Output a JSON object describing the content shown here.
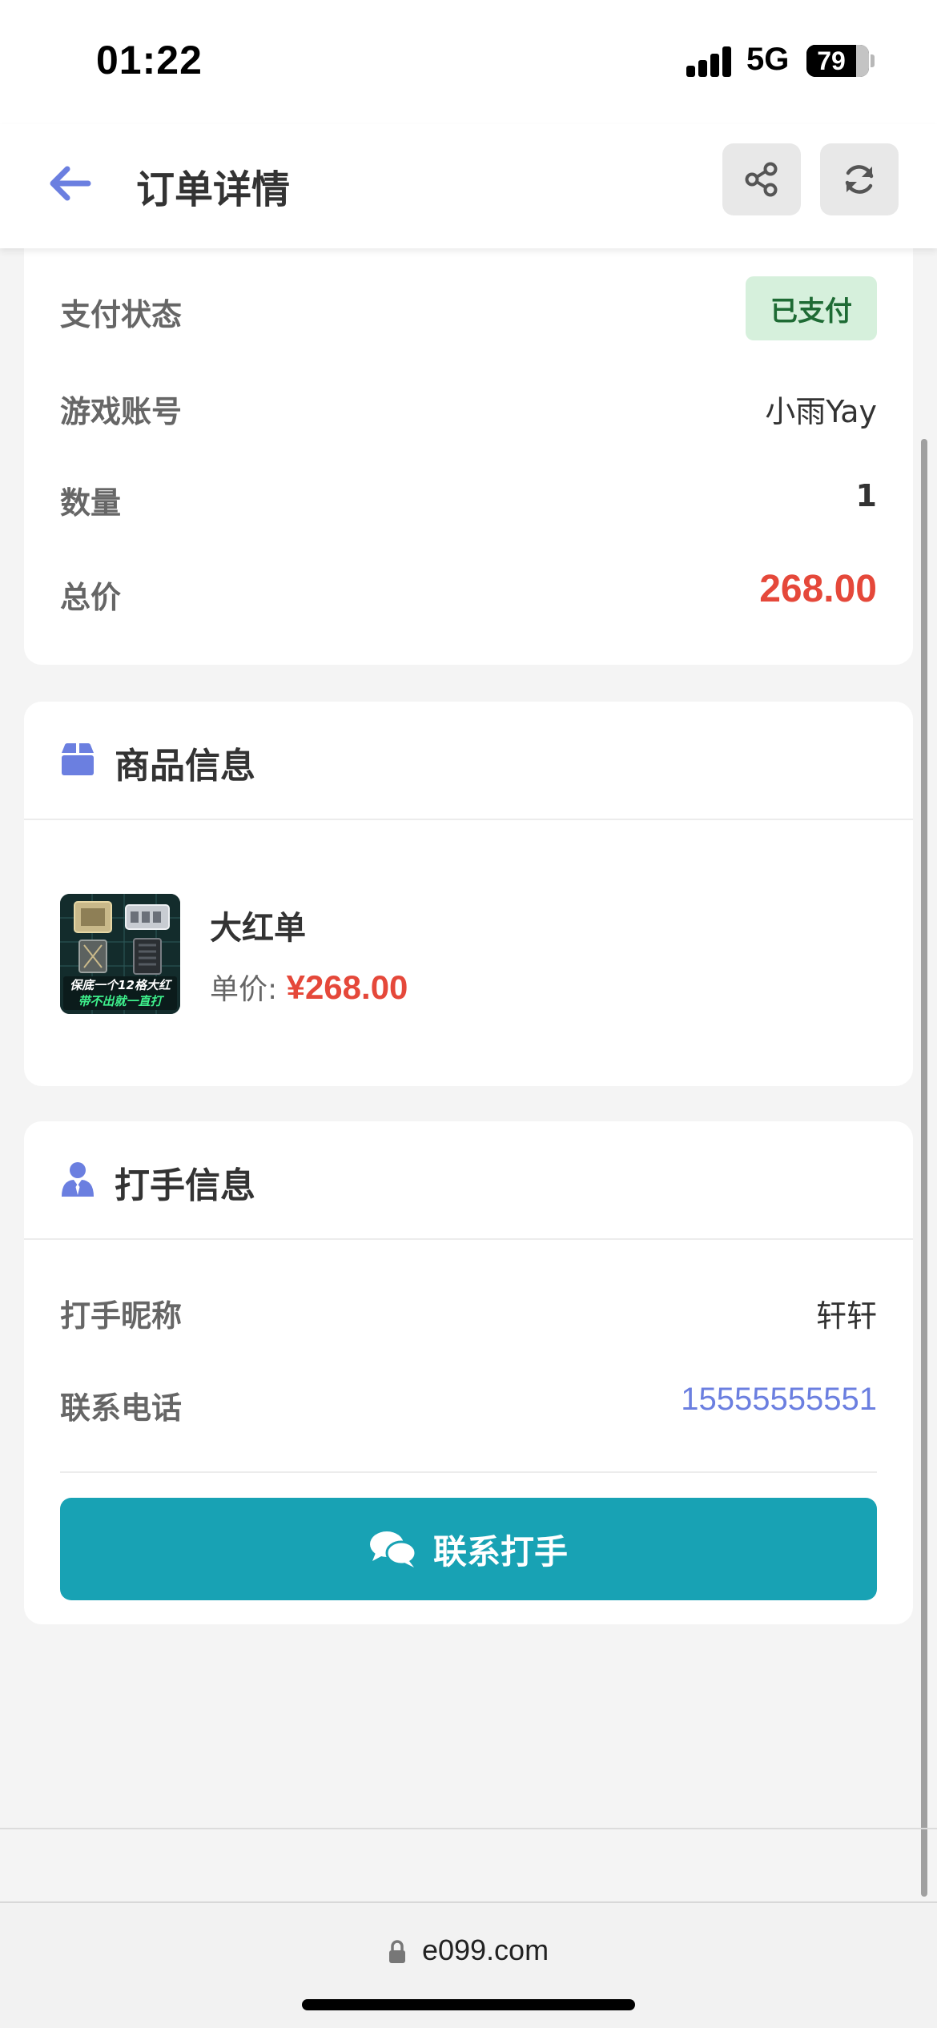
{
  "status_bar": {
    "time": "01:22",
    "network": "5G",
    "battery": "79"
  },
  "header": {
    "title": "订单详情"
  },
  "order_card": {
    "pay_status_label": "支付状态",
    "pay_status_value": "已支付",
    "account_label": "游戏账号",
    "account_value": "小雨Yay",
    "quantity_label": "数量",
    "quantity_value": "1",
    "total_label": "总价",
    "total_value": "268.00"
  },
  "product_card": {
    "title": "商品信息",
    "product_name": "大红单",
    "unit_price_label": "单价:",
    "unit_price_value": "¥268.00",
    "thumb_line1": "保底一个12格大红",
    "thumb_line2": "带不出就一直打"
  },
  "player_card": {
    "title": "打手信息",
    "nickname_label": "打手昵称",
    "nickname_value": "轩轩",
    "phone_label": "联系电话",
    "phone_value": "15555555551",
    "contact_button": "联系打手"
  },
  "browser": {
    "url": "e099.com"
  },
  "colors": {
    "accent": "#6b7fe0",
    "price": "#e5483a",
    "button": "#18a2b4",
    "paid_badge_bg": "#d6f0dc",
    "paid_badge_text": "#1e6b34"
  },
  "icons": [
    "back-arrow-icon",
    "share-icon",
    "refresh-icon",
    "box-icon",
    "user-tie-icon",
    "chat-icon",
    "lock-icon"
  ]
}
